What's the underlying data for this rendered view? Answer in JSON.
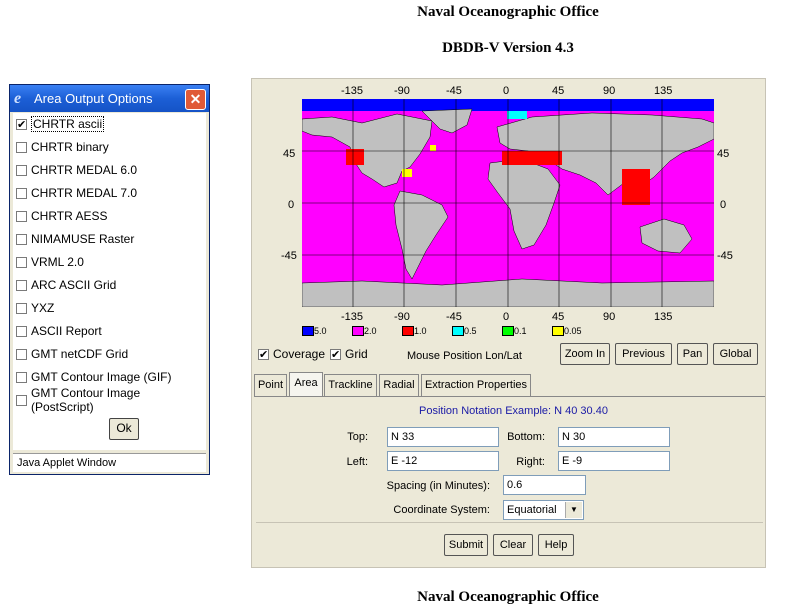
{
  "header": {
    "org": "Naval Oceanographic Office",
    "version": "DBDB-V Version 4.3"
  },
  "footer": {
    "org": "Naval Oceanographic Office"
  },
  "output_window": {
    "title": "Area Output Options",
    "options": [
      {
        "label": "CHRTR ascii",
        "checked": true
      },
      {
        "label": "CHRTR binary",
        "checked": false
      },
      {
        "label": "CHRTR MEDAL 6.0",
        "checked": false
      },
      {
        "label": "CHRTR MEDAL 7.0",
        "checked": false
      },
      {
        "label": "CHRTR AESS",
        "checked": false
      },
      {
        "label": "NIMAMUSE Raster",
        "checked": false
      },
      {
        "label": "VRML 2.0",
        "checked": false
      },
      {
        "label": "ARC ASCII Grid",
        "checked": false
      },
      {
        "label": "YXZ",
        "checked": false
      },
      {
        "label": "ASCII Report",
        "checked": false
      },
      {
        "label": "GMT netCDF Grid",
        "checked": false
      },
      {
        "label": "GMT Contour Image (GIF)",
        "checked": false
      },
      {
        "label": "GMT Contour Image (PostScript)",
        "checked": false
      }
    ],
    "ok_label": "Ok",
    "status": "Java Applet Window"
  },
  "map": {
    "lon_labels": [
      "-135",
      "-90",
      "-45",
      "0",
      "45",
      "90",
      "135"
    ],
    "lat_labels": [
      "45",
      "0",
      "-45"
    ],
    "legend": [
      {
        "label": "5.0",
        "color": "#0000ff"
      },
      {
        "label": "2.0",
        "color": "#ff00ff"
      },
      {
        "label": "1.0",
        "color": "#ff0000"
      },
      {
        "label": "0.5",
        "color": "#00ffff"
      },
      {
        "label": "0.1",
        "color": "#00ff00"
      },
      {
        "label": "0.05",
        "color": "#ffff00"
      }
    ]
  },
  "controls": {
    "coverage": {
      "label": "Coverage",
      "checked": true
    },
    "grid": {
      "label": "Grid",
      "checked": true
    },
    "mouse_position": "Mouse Position Lon/Lat",
    "zoom_in": "Zoom In",
    "previous": "Previous",
    "pan": "Pan",
    "global": "Global"
  },
  "tabs": [
    "Point",
    "Area",
    "Trackline",
    "Radial",
    "Extraction Properties"
  ],
  "active_tab": "Area",
  "form": {
    "example": "Position Notation Example: N 40 30.40",
    "top_label": "Top:",
    "top_value": "N 33",
    "bottom_label": "Bottom:",
    "bottom_value": "N 30",
    "left_label": "Left:",
    "left_value": "E -12",
    "right_label": "Right:",
    "right_value": "E -9",
    "spacing_label": "Spacing (in Minutes):",
    "spacing_value": "0.6",
    "coord_label": "Coordinate System:",
    "coord_value": "Equatorial",
    "submit": "Submit",
    "clear": "Clear",
    "help": "Help"
  }
}
